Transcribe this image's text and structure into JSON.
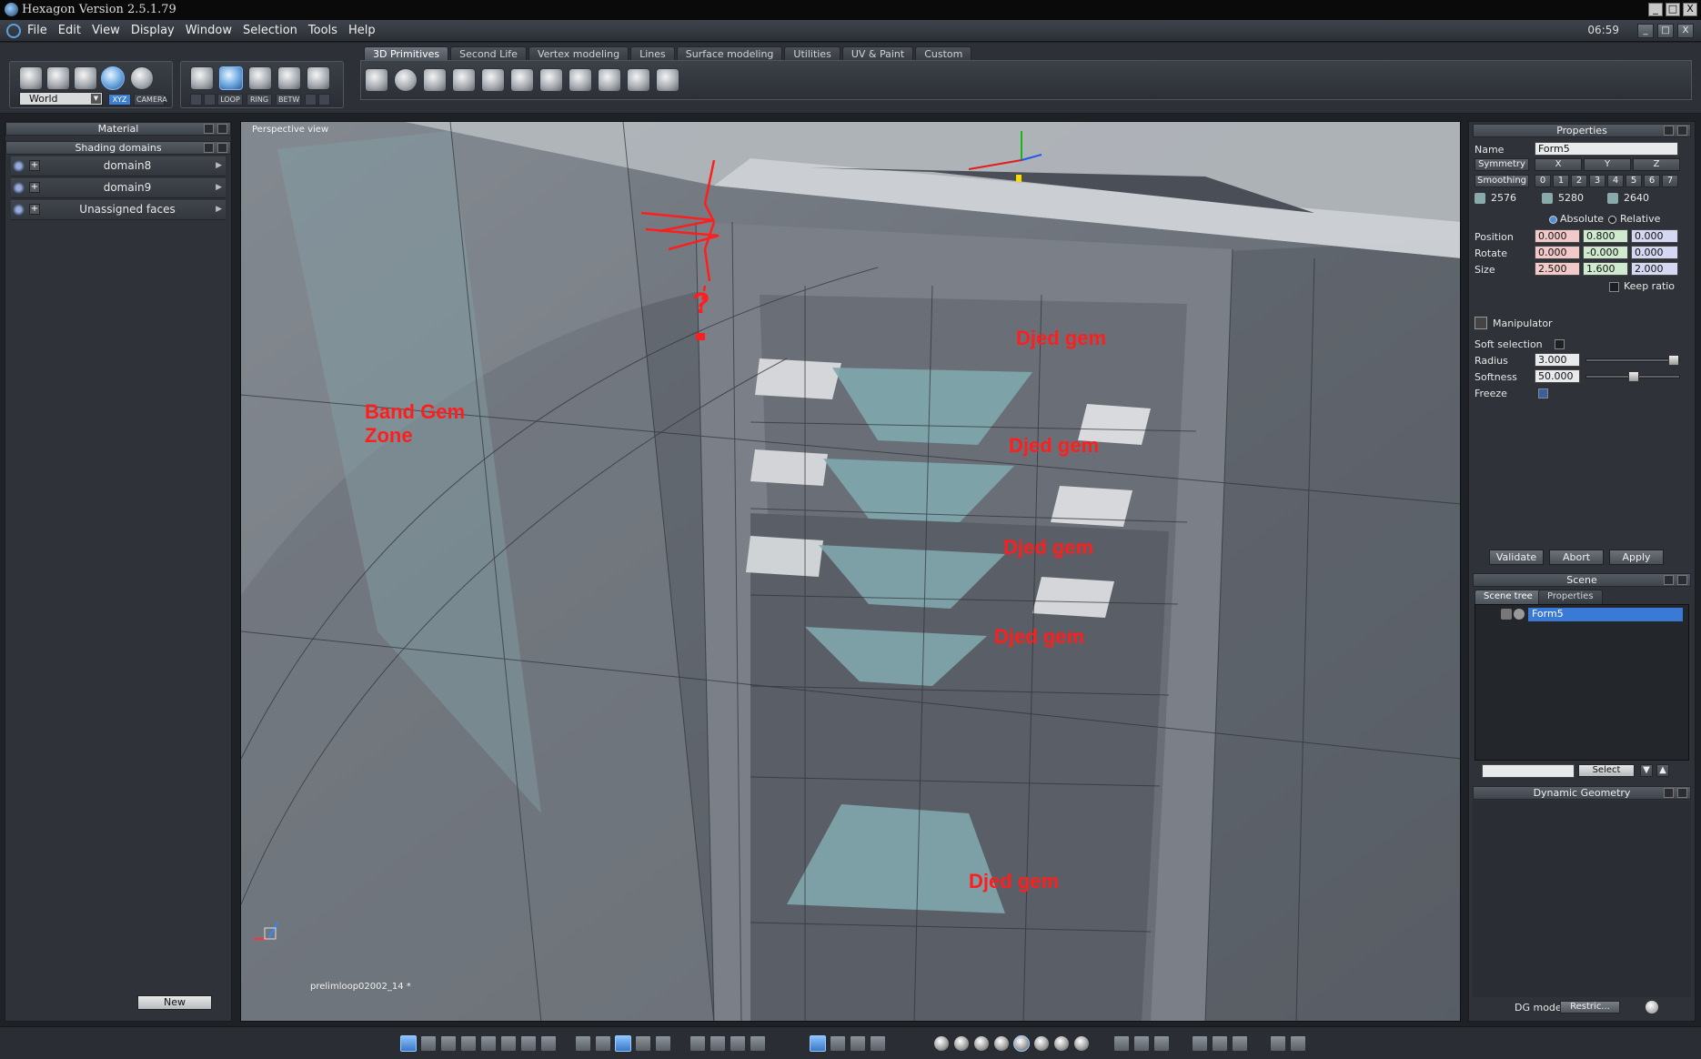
{
  "window": {
    "title": "Hexagon Version 2.5.1.79",
    "minimize": "_",
    "maximize": "□",
    "close": "X",
    "clock": "06:59"
  },
  "menu": [
    "File",
    "Edit",
    "View",
    "Display",
    "Window",
    "Selection",
    "Tools",
    "Help"
  ],
  "toolbar": {
    "coord_system": "World",
    "xyz_label": "XYZ",
    "camera_label": "CAMERA",
    "loop_label": "LOOP",
    "ring_label": "RING",
    "betw_label": "BETW",
    "tabs": [
      "3D Primitives",
      "Second Life",
      "Vertex modeling",
      "Lines",
      "Surface modeling",
      "Utilities",
      "UV & Paint",
      "Custom"
    ],
    "active_tab": "3D Primitives"
  },
  "left_panel": {
    "material_title": "Material",
    "shading_title": "Shading domains",
    "domains": [
      "domain8",
      "domain9",
      "Unassigned faces"
    ],
    "new_button": "New"
  },
  "viewport": {
    "title": "Perspective view",
    "file_label": "prelimloop02002_14 *",
    "annotations": {
      "band_gem": "Band Gem\nZone",
      "question": "?",
      "djed1": "Djed gem",
      "djed2": "Djed gem",
      "djed3": "Djed gem",
      "djed4": "Djed gem",
      "djed5": "Djed gem"
    }
  },
  "properties": {
    "title": "Properties",
    "name_label": "Name",
    "name_value": "Form5",
    "symmetry_label": "Symmetry",
    "sym_x": "X",
    "sym_y": "Y",
    "sym_z": "Z",
    "smoothing_label": "Smoothing",
    "smoothing_levels": [
      "0",
      "1",
      "2",
      "3",
      "4",
      "5",
      "6",
      "7"
    ],
    "stats": [
      "2576",
      "5280",
      "2640"
    ],
    "absolute_label": "Absolute",
    "relative_label": "Relative",
    "position_label": "Position",
    "position": [
      "0.000",
      "0.800",
      "0.000"
    ],
    "rotate_label": "Rotate",
    "rotate": [
      "0.000",
      "-0.000",
      "0.000"
    ],
    "size_label": "Size",
    "size": [
      "2.500",
      "1.600",
      "2.000"
    ],
    "keep_ratio_label": "Keep ratio",
    "manipulator_label": "Manipulator",
    "soft_selection_label": "Soft selection",
    "radius_label": "Radius",
    "radius_value": "3.000",
    "softness_label": "Softness",
    "softness_value": "50.000",
    "freeze_label": "Freeze",
    "validate_button": "Validate",
    "abort_button": "Abort",
    "apply_button": "Apply"
  },
  "scene": {
    "title": "Scene",
    "tab_tree": "Scene tree",
    "tab_properties": "Properties",
    "selected_item": "Form5",
    "select_button": "Select"
  },
  "dynamic_geometry": {
    "title": "Dynamic Geometry",
    "dg_mode_label": "DG mode:",
    "dg_mode_value": "Restric..."
  },
  "colors": {
    "annotation_red": "#ff1e1e",
    "accent_blue": "#3d7fd3",
    "gem_cyan": "#7fa7ad"
  }
}
